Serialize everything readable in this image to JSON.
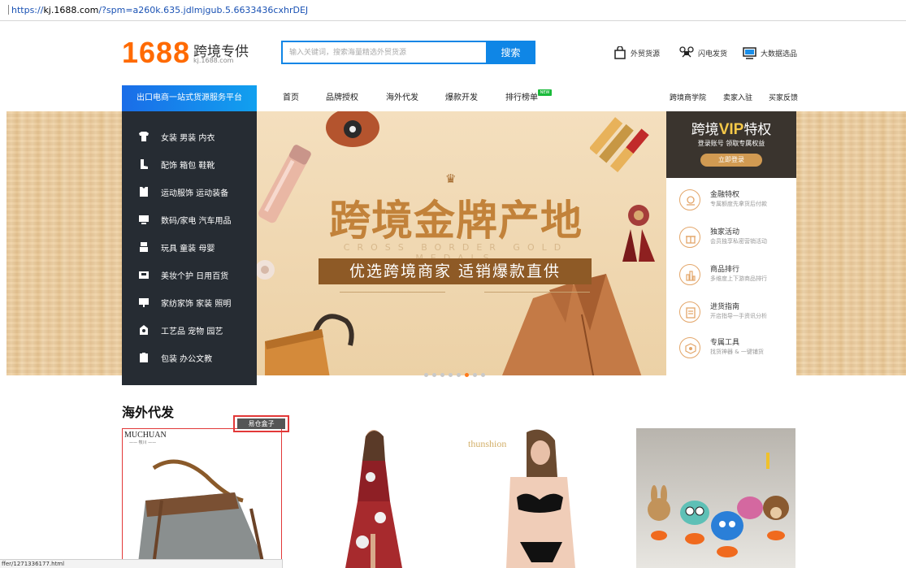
{
  "browser": {
    "url_prefix": "https://",
    "url_domain": "kj.1688.com",
    "url_rest": "/?spm=a260k.635.jdlmjgub.5.6633436cxhrDEJ",
    "status_url": "ffer/1271336177.html"
  },
  "header": {
    "logo_number": "1688",
    "logo_title": "跨境专供",
    "logo_url": "kj.1688.com",
    "search_placeholder": "输入关键词，搜索海量精选外贸货源",
    "search_button": "搜索",
    "links": [
      "外贸货源",
      "闪电发货",
      "大数据选品"
    ]
  },
  "nav": {
    "category_label": "出口电商一站式货源服务平台",
    "items": [
      "首页",
      "品牌授权",
      "海外代发",
      "爆款开发",
      "排行榜单"
    ],
    "new_badge": "NEW",
    "right_items": [
      "跨境商学院",
      "卖家入驻",
      "买家反馈"
    ]
  },
  "categories": [
    {
      "label": "女装 男装 内衣",
      "icon": "clothing-icon"
    },
    {
      "label": "配饰 箱包 鞋靴",
      "icon": "boot-icon"
    },
    {
      "label": "运动服饰 运动装备",
      "icon": "sportswear-icon"
    },
    {
      "label": "数码/家电 汽车用品",
      "icon": "monitor-icon"
    },
    {
      "label": "玩具 童装 母婴",
      "icon": "toy-icon"
    },
    {
      "label": "美妆个护 日用百货",
      "icon": "cosmetics-icon"
    },
    {
      "label": "家纺家饰 家装 照明",
      "icon": "lamp-icon"
    },
    {
      "label": "工艺品 宠物 园艺",
      "icon": "craft-icon"
    },
    {
      "label": "包装 办公文教",
      "icon": "office-icon"
    }
  ],
  "banner": {
    "title": "跨境金牌产地",
    "subtitle": "CROSS BORDER GOLD MEDALS",
    "slogan": "优选跨境商家 适销爆款直供",
    "active_slide": 5,
    "slide_count": 8
  },
  "vip": {
    "title_prefix": "跨境",
    "title_vip": "VIP",
    "title_suffix": "特权",
    "subtitle": "登录账号 领取专属权益",
    "button": "立即登录"
  },
  "services": [
    {
      "title": "金融特权",
      "desc": "专属额度先拿货后付款",
      "icon": "finance-icon"
    },
    {
      "title": "独家活动",
      "desc": "会员独享私密营销活动",
      "icon": "gift-icon"
    },
    {
      "title": "商品排行",
      "desc": "多维度上下游商品排行",
      "icon": "ranking-icon"
    },
    {
      "title": "进货指南",
      "desc": "开店指导一手资讯分析",
      "icon": "guide-icon"
    },
    {
      "title": "专属工具",
      "desc": "找货神器 & 一键铺货",
      "icon": "tool-icon"
    }
  ],
  "section": {
    "title": "海外代发",
    "tooltip": "易仓盒子"
  },
  "products": [
    {
      "brand": "MUCHUAN",
      "brand_sub": "—— 牧川 ——"
    },
    {
      "brand": ""
    },
    {
      "brand": "thunshion"
    },
    {
      "brand": ""
    }
  ]
}
